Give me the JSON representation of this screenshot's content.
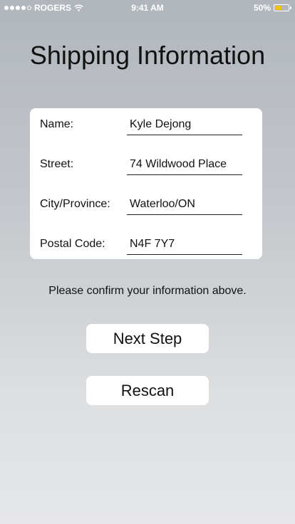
{
  "status_bar": {
    "carrier": "ROGERS",
    "signal_bars_filled": 4,
    "signal_bars_total": 5,
    "time": "9:41 AM",
    "battery_percent_label": "50%",
    "battery_level": 0.5,
    "battery_color": "#f2c500",
    "icons": [
      "signal-dots-icon",
      "wifi-icon",
      "battery-icon"
    ]
  },
  "page": {
    "title": "Shipping Information"
  },
  "form": {
    "name_label": "Name:",
    "name_value": "Kyle Dejong",
    "street_label": "Street:",
    "street_value": "74 Wildwood Place",
    "city_label": "City/Province:",
    "city_value": "Waterloo/ON",
    "postal_label": "Postal Code:",
    "postal_value": "N4F 7Y7"
  },
  "confirm_text": "Please confirm your information above.",
  "buttons": {
    "next_label": "Next Step",
    "rescan_label": "Rescan"
  }
}
